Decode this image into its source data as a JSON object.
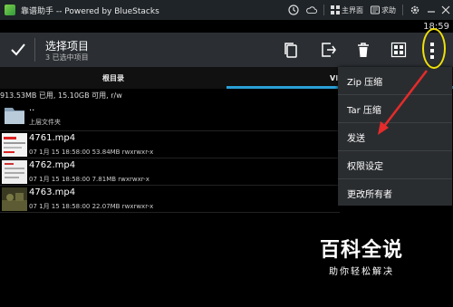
{
  "titlebar": {
    "title": "靠谱助手 -- Powered by BlueStacks",
    "home_label": "主界面",
    "help_label": "求助"
  },
  "status": {
    "time": "18:59"
  },
  "actionbar": {
    "title": "选择项目",
    "subtitle": "3 已选中项目"
  },
  "tabs": [
    {
      "label": "根目录"
    },
    {
      "label": "VI"
    }
  ],
  "storage": "913.53MB 已用, 15.10GB 可用, r/w",
  "parent": {
    "name": "..",
    "label": "上层文件夹"
  },
  "files": [
    {
      "name": "4761.mp4",
      "meta": "07 1月 15 18:58:00  53.84MB  rwxrwxr-x"
    },
    {
      "name": "4762.mp4",
      "meta": "07 1月 15 18:58:00  7.81MB  rwxrwxr-x"
    },
    {
      "name": "4763.mp4",
      "meta": "07 1月 15 18:58:00  22.07MB  rwxrwxr-x"
    }
  ],
  "menu": {
    "items": [
      {
        "label": "Zip 压缩"
      },
      {
        "label": "Tar 压缩"
      },
      {
        "label": "发送"
      },
      {
        "label": "权限设定"
      },
      {
        "label": "更改所有者"
      }
    ]
  },
  "watermark": {
    "title": "百科全说",
    "subtitle": "助你轻松解决"
  },
  "colors": {
    "accent_tab": "#2a9fd6",
    "highlight": "#f0e10a",
    "arrow": "#e52b2b",
    "actionbar": "#2b2f33",
    "menu": "#2a2d30"
  }
}
